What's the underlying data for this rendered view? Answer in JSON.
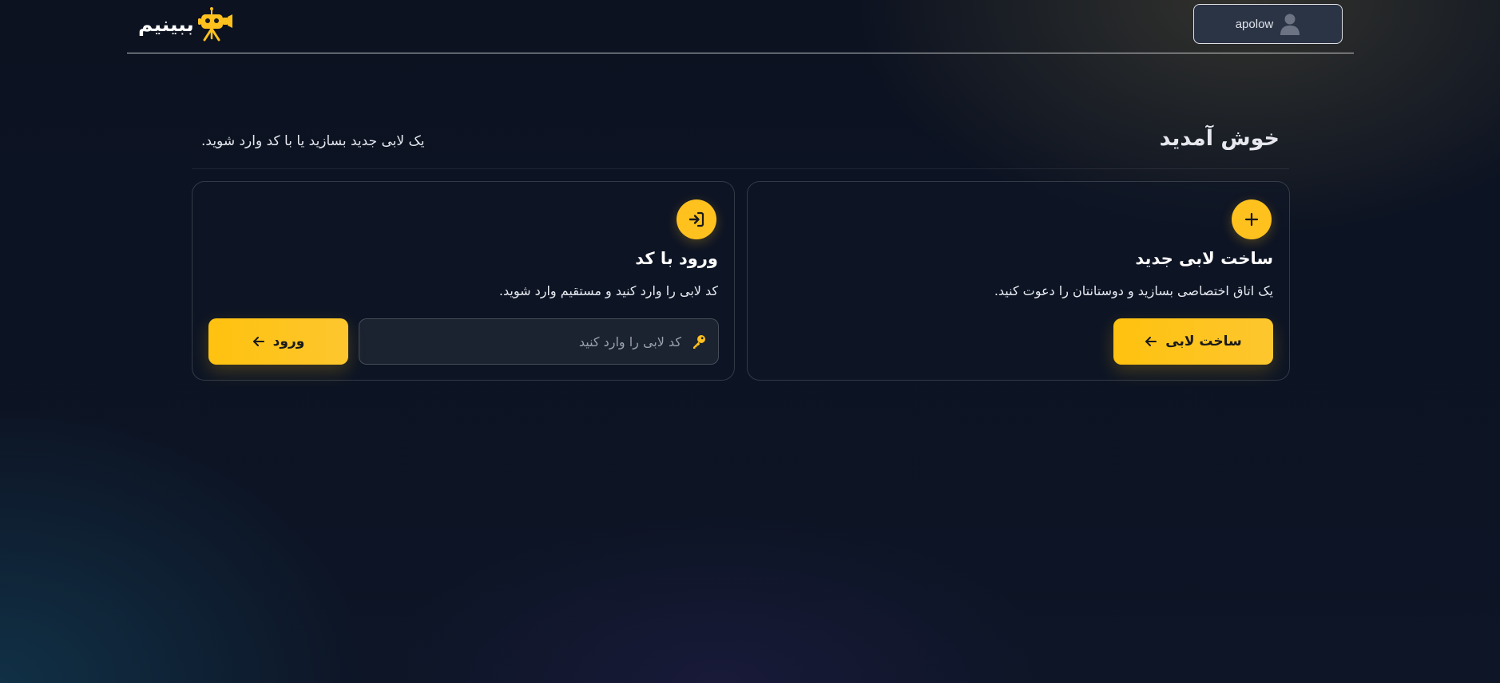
{
  "header": {
    "brand_name": "ببینیم",
    "brand_logo_icon": "robot-camera-logo-icon",
    "user": {
      "name": "apolow",
      "icon": "user-avatar-icon"
    }
  },
  "welcome": {
    "title": "خوش آمدید",
    "subtitle": "یک لابی جدید بسازید یا با کد وارد شوید."
  },
  "create_card": {
    "icon": "plus-icon",
    "title": "ساخت لابی جدید",
    "description": "یک اتاق اختصاصی بسازید و دوستانتان را دعوت کنید.",
    "button_label": "ساخت لابی",
    "button_icon": "arrow-left-icon"
  },
  "join_card": {
    "icon": "sign-in-icon",
    "title": "ورود با کد",
    "description": "کد لابی را وارد کنید و مستقیم وارد شوید.",
    "input_placeholder": "کد لابی را وارد کنید",
    "input_value": "",
    "input_icon": "key-icon",
    "button_label": "ورود",
    "button_icon": "arrow-left-icon"
  },
  "colors": {
    "accent": "#fec11e",
    "background": "#0d1526",
    "card_border": "#2a3142"
  }
}
